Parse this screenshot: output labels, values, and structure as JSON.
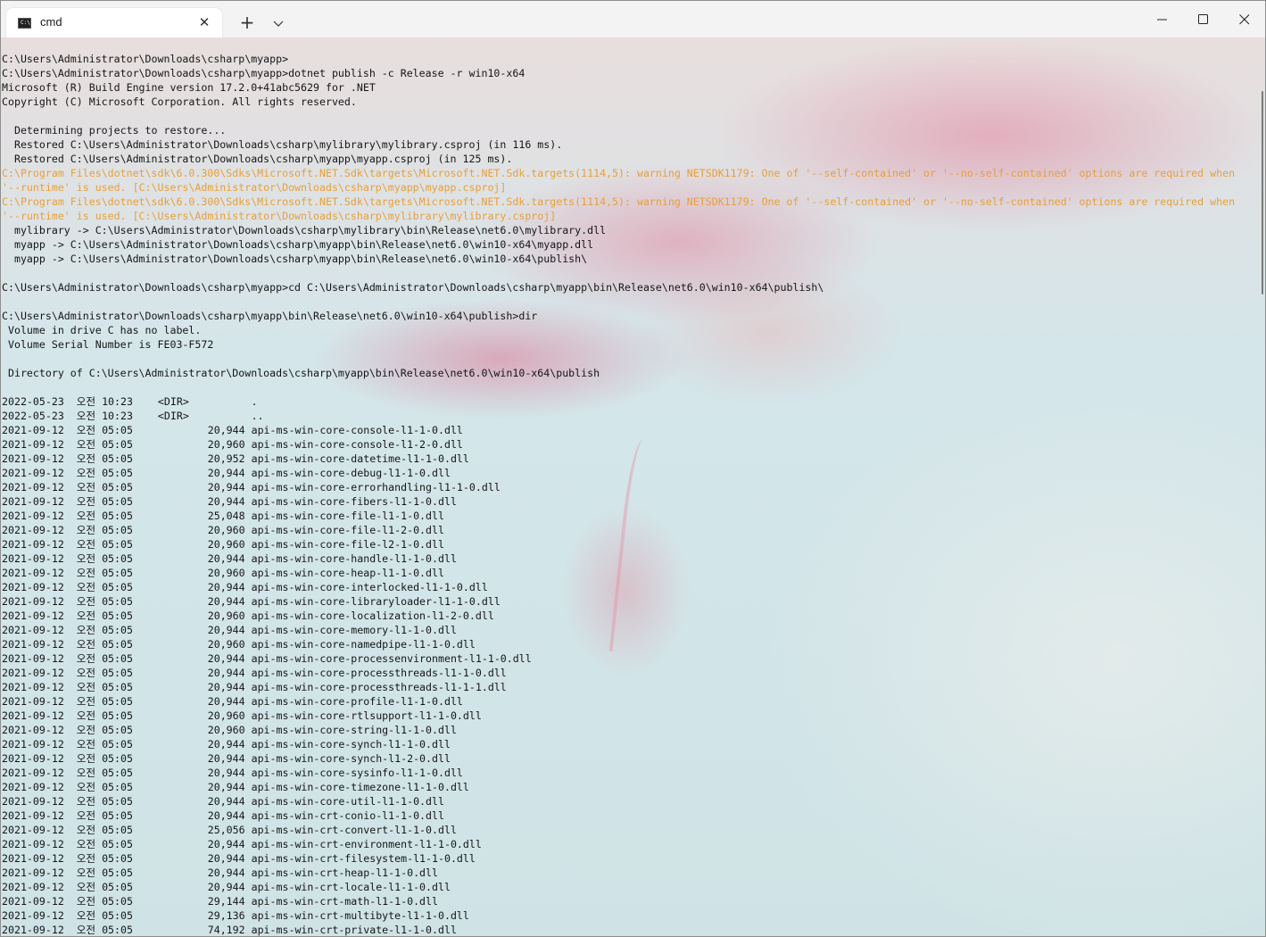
{
  "window": {
    "tab_title": "cmd",
    "tab_icon": "command-prompt-icon",
    "tab_icon_text": "C:\\."
  },
  "colors": {
    "text": "#151515",
    "warning": "#e6a03c",
    "titlebar": "#f3f3f3"
  },
  "terminal": {
    "lines": [
      {
        "text": "C:\\Users\\Administrator\\Downloads\\csharp\\myapp>"
      },
      {
        "text": "C:\\Users\\Administrator\\Downloads\\csharp\\myapp>dotnet publish -c Release -r win10-x64"
      },
      {
        "text": "Microsoft (R) Build Engine version 17.2.0+41abc5629 for .NET"
      },
      {
        "text": "Copyright (C) Microsoft Corporation. All rights reserved."
      },
      {
        "text": ""
      },
      {
        "text": "  Determining projects to restore..."
      },
      {
        "text": "  Restored C:\\Users\\Administrator\\Downloads\\csharp\\mylibrary\\mylibrary.csproj (in 116 ms)."
      },
      {
        "text": "  Restored C:\\Users\\Administrator\\Downloads\\csharp\\myapp\\myapp.csproj (in 125 ms)."
      },
      {
        "text": "C:\\Program Files\\dotnet\\sdk\\6.0.300\\Sdks\\Microsoft.NET.Sdk\\targets\\Microsoft.NET.Sdk.targets(1114,5): warning NETSDK1179: One of '--self-contained' or '--no-self-contained' options are required when",
        "warn": true
      },
      {
        "text": "'--runtime' is used. [C:\\Users\\Administrator\\Downloads\\csharp\\myapp\\myapp.csproj]",
        "warn": true
      },
      {
        "text": "C:\\Program Files\\dotnet\\sdk\\6.0.300\\Sdks\\Microsoft.NET.Sdk\\targets\\Microsoft.NET.Sdk.targets(1114,5): warning NETSDK1179: One of '--self-contained' or '--no-self-contained' options are required when",
        "warn": true
      },
      {
        "text": "'--runtime' is used. [C:\\Users\\Administrator\\Downloads\\csharp\\mylibrary\\mylibrary.csproj]",
        "warn": true
      },
      {
        "text": "  mylibrary -> C:\\Users\\Administrator\\Downloads\\csharp\\mylibrary\\bin\\Release\\net6.0\\mylibrary.dll"
      },
      {
        "text": "  myapp -> C:\\Users\\Administrator\\Downloads\\csharp\\myapp\\bin\\Release\\net6.0\\win10-x64\\myapp.dll"
      },
      {
        "text": "  myapp -> C:\\Users\\Administrator\\Downloads\\csharp\\myapp\\bin\\Release\\net6.0\\win10-x64\\publish\\"
      },
      {
        "text": ""
      },
      {
        "text": "C:\\Users\\Administrator\\Downloads\\csharp\\myapp>cd C:\\Users\\Administrator\\Downloads\\csharp\\myapp\\bin\\Release\\net6.0\\win10-x64\\publish\\"
      },
      {
        "text": ""
      },
      {
        "text": "C:\\Users\\Administrator\\Downloads\\csharp\\myapp\\bin\\Release\\net6.0\\win10-x64\\publish>dir"
      },
      {
        "text": " Volume in drive C has no label."
      },
      {
        "text": " Volume Serial Number is FE03-F572"
      },
      {
        "text": ""
      },
      {
        "text": " Directory of C:\\Users\\Administrator\\Downloads\\csharp\\myapp\\bin\\Release\\net6.0\\win10-x64\\publish"
      },
      {
        "text": ""
      },
      {
        "text": "2022-05-23  오전 10:23    <DIR>          ."
      },
      {
        "text": "2022-05-23  오전 10:23    <DIR>          .."
      },
      {
        "text": "2021-09-12  오전 05:05            20,944 api-ms-win-core-console-l1-1-0.dll"
      },
      {
        "text": "2021-09-12  오전 05:05            20,960 api-ms-win-core-console-l1-2-0.dll"
      },
      {
        "text": "2021-09-12  오전 05:05            20,952 api-ms-win-core-datetime-l1-1-0.dll"
      },
      {
        "text": "2021-09-12  오전 05:05            20,944 api-ms-win-core-debug-l1-1-0.dll"
      },
      {
        "text": "2021-09-12  오전 05:05            20,944 api-ms-win-core-errorhandling-l1-1-0.dll"
      },
      {
        "text": "2021-09-12  오전 05:05            20,944 api-ms-win-core-fibers-l1-1-0.dll"
      },
      {
        "text": "2021-09-12  오전 05:05            25,048 api-ms-win-core-file-l1-1-0.dll"
      },
      {
        "text": "2021-09-12  오전 05:05            20,960 api-ms-win-core-file-l1-2-0.dll"
      },
      {
        "text": "2021-09-12  오전 05:05            20,960 api-ms-win-core-file-l2-1-0.dll"
      },
      {
        "text": "2021-09-12  오전 05:05            20,944 api-ms-win-core-handle-l1-1-0.dll"
      },
      {
        "text": "2021-09-12  오전 05:05            20,960 api-ms-win-core-heap-l1-1-0.dll"
      },
      {
        "text": "2021-09-12  오전 05:05            20,944 api-ms-win-core-interlocked-l1-1-0.dll"
      },
      {
        "text": "2021-09-12  오전 05:05            20,944 api-ms-win-core-libraryloader-l1-1-0.dll"
      },
      {
        "text": "2021-09-12  오전 05:05            20,960 api-ms-win-core-localization-l1-2-0.dll"
      },
      {
        "text": "2021-09-12  오전 05:05            20,944 api-ms-win-core-memory-l1-1-0.dll"
      },
      {
        "text": "2021-09-12  오전 05:05            20,960 api-ms-win-core-namedpipe-l1-1-0.dll"
      },
      {
        "text": "2021-09-12  오전 05:05            20,944 api-ms-win-core-processenvironment-l1-1-0.dll"
      },
      {
        "text": "2021-09-12  오전 05:05            20,944 api-ms-win-core-processthreads-l1-1-0.dll"
      },
      {
        "text": "2021-09-12  오전 05:05            20,944 api-ms-win-core-processthreads-l1-1-1.dll"
      },
      {
        "text": "2021-09-12  오전 05:05            20,944 api-ms-win-core-profile-l1-1-0.dll"
      },
      {
        "text": "2021-09-12  오전 05:05            20,960 api-ms-win-core-rtlsupport-l1-1-0.dll"
      },
      {
        "text": "2021-09-12  오전 05:05            20,960 api-ms-win-core-string-l1-1-0.dll"
      },
      {
        "text": "2021-09-12  오전 05:05            20,944 api-ms-win-core-synch-l1-1-0.dll"
      },
      {
        "text": "2021-09-12  오전 05:05            20,944 api-ms-win-core-synch-l1-2-0.dll"
      },
      {
        "text": "2021-09-12  오전 05:05            20,944 api-ms-win-core-sysinfo-l1-1-0.dll"
      },
      {
        "text": "2021-09-12  오전 05:05            20,944 api-ms-win-core-timezone-l1-1-0.dll"
      },
      {
        "text": "2021-09-12  오전 05:05            20,944 api-ms-win-core-util-l1-1-0.dll"
      },
      {
        "text": "2021-09-12  오전 05:05            20,944 api-ms-win-crt-conio-l1-1-0.dll"
      },
      {
        "text": "2021-09-12  오전 05:05            25,056 api-ms-win-crt-convert-l1-1-0.dll"
      },
      {
        "text": "2021-09-12  오전 05:05            20,944 api-ms-win-crt-environment-l1-1-0.dll"
      },
      {
        "text": "2021-09-12  오전 05:05            20,944 api-ms-win-crt-filesystem-l1-1-0.dll"
      },
      {
        "text": "2021-09-12  오전 05:05            20,944 api-ms-win-crt-heap-l1-1-0.dll"
      },
      {
        "text": "2021-09-12  오전 05:05            20,944 api-ms-win-crt-locale-l1-1-0.dll"
      },
      {
        "text": "2021-09-12  오전 05:05            29,144 api-ms-win-crt-math-l1-1-0.dll"
      },
      {
        "text": "2021-09-12  오전 05:05            29,136 api-ms-win-crt-multibyte-l1-1-0.dll"
      },
      {
        "text": "2021-09-12  오전 05:05            74,192 api-ms-win-crt-private-l1-1-0.dll"
      }
    ]
  }
}
